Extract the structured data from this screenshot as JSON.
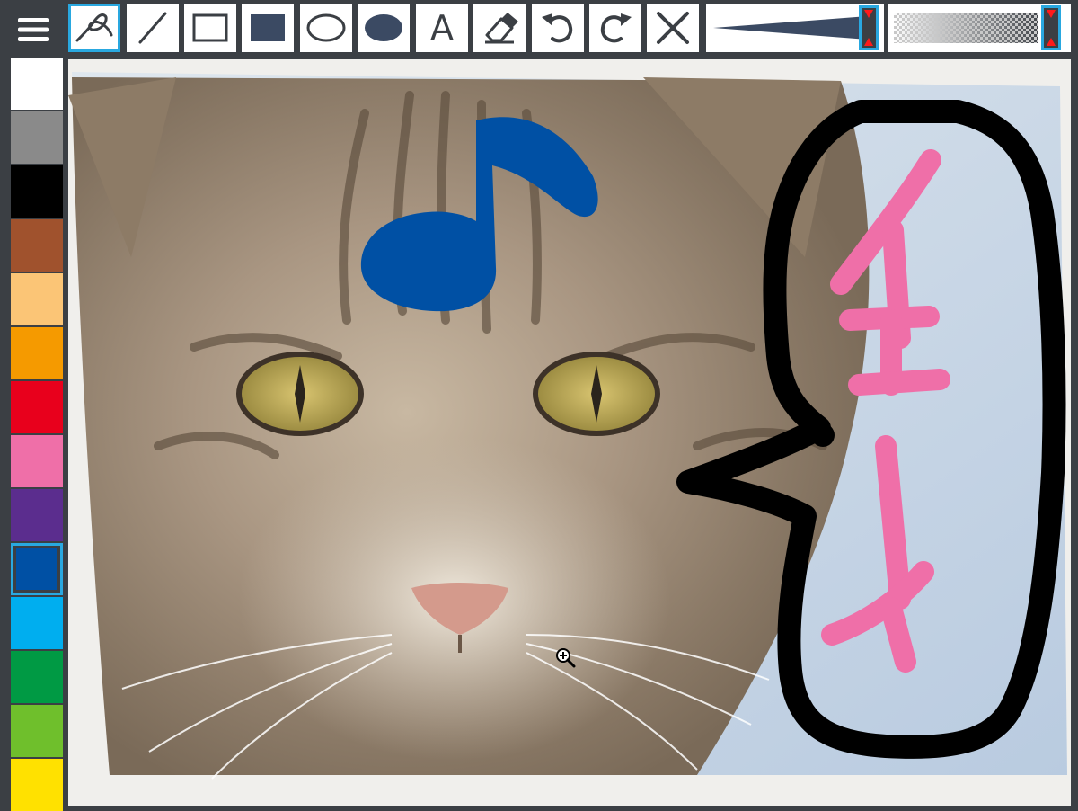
{
  "toolbar": {
    "menu_icon": "hamburger-icon",
    "tools": [
      {
        "name": "pen",
        "icon": "freehand-pen-icon",
        "active": true
      },
      {
        "name": "line",
        "icon": "line-icon",
        "active": false
      },
      {
        "name": "rectangle",
        "icon": "rectangle-outline-icon",
        "active": false
      },
      {
        "name": "filled-rectangle",
        "icon": "rectangle-filled-icon",
        "active": false
      },
      {
        "name": "ellipse",
        "icon": "ellipse-outline-icon",
        "active": false
      },
      {
        "name": "filled-ellipse",
        "icon": "ellipse-filled-icon",
        "active": false
      },
      {
        "name": "text",
        "icon": "text-icon",
        "label": "A",
        "active": false
      },
      {
        "name": "eraser",
        "icon": "eraser-icon",
        "active": false
      },
      {
        "name": "undo",
        "icon": "undo-icon",
        "active": false
      },
      {
        "name": "redo",
        "icon": "redo-icon",
        "active": false
      },
      {
        "name": "clear",
        "icon": "close-icon",
        "active": false
      }
    ],
    "brush_size_level": 1.0,
    "opacity_level": 1.0
  },
  "palette": {
    "colors": [
      "#ffffff",
      "#8a8a8a",
      "#000000",
      "#a0522d",
      "#fbc576",
      "#f59a00",
      "#e8001c",
      "#ef6fa8",
      "#5b2d8e",
      "#0050a4",
      "#00aeef",
      "#009a44",
      "#6fbf2c",
      "#ffe100"
    ],
    "selected_index": 9
  },
  "canvas": {
    "drawing": {
      "note_symbol": "eighth-note",
      "note_color": "#0050a4",
      "bubble_color": "#000000",
      "bubble_text": "イエーイ",
      "bubble_text_color": "#ef6fa8"
    }
  },
  "accent": "#29a8e0"
}
